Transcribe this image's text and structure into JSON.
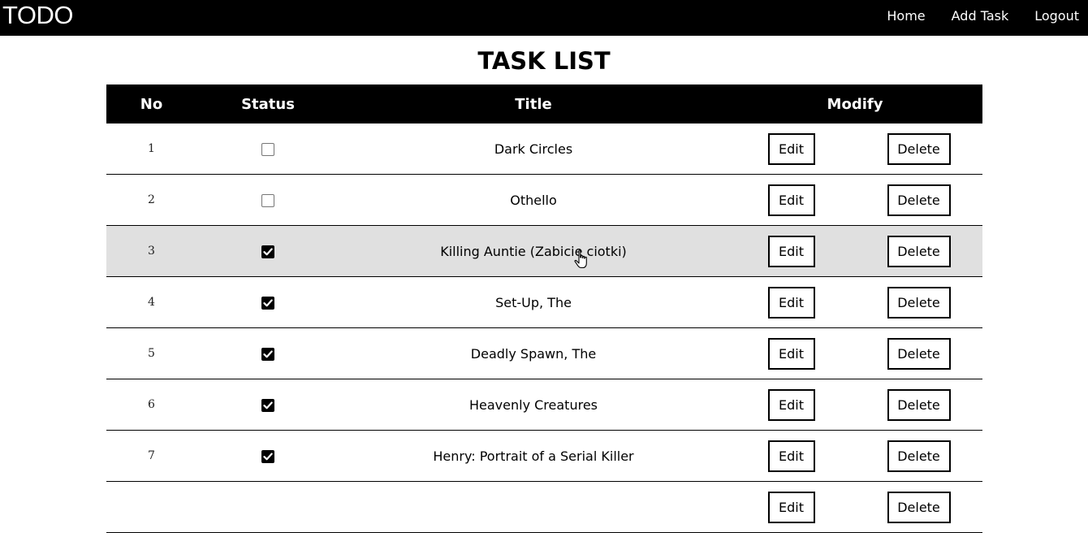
{
  "navbar": {
    "brand": "TODO",
    "links": [
      {
        "label": "Home"
      },
      {
        "label": "Add Task"
      },
      {
        "label": "Logout"
      }
    ]
  },
  "page": {
    "title": "TASK LIST"
  },
  "table": {
    "headers": {
      "no": "No",
      "status": "Status",
      "title": "Title",
      "modify": "Modify"
    },
    "edit_label": "Edit",
    "delete_label": "Delete",
    "rows": [
      {
        "no": "1",
        "checked": false,
        "title": "Dark Circles"
      },
      {
        "no": "2",
        "checked": false,
        "title": "Othello"
      },
      {
        "no": "3",
        "checked": true,
        "title": "Killing Auntie (Zabicie ciotki)"
      },
      {
        "no": "4",
        "checked": true,
        "title": "Set-Up, The"
      },
      {
        "no": "5",
        "checked": true,
        "title": "Deadly Spawn, The"
      },
      {
        "no": "6",
        "checked": true,
        "title": "Heavenly Creatures"
      },
      {
        "no": "7",
        "checked": true,
        "title": "Henry: Portrait of a Serial Killer"
      },
      {
        "no": "",
        "checked": false,
        "title": ""
      }
    ],
    "hovered_row": "3"
  },
  "icons": {
    "checkbox_checked": "checkmark-icon",
    "cursor": "hand-pointer-icon"
  },
  "colors": {
    "navbar_bg": "#000000",
    "header_bg": "#000000",
    "hover_row_bg": "#e0e0e0"
  }
}
